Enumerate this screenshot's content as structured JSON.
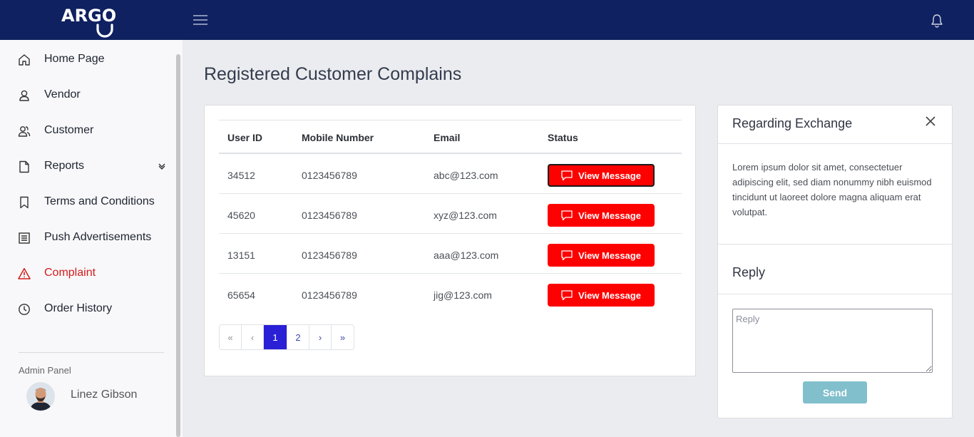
{
  "header": {
    "logo_text": "ARGO",
    "menu_icon": "hamburger-menu-icon",
    "notification_icon": "bell-icon"
  },
  "sidebar": {
    "items": [
      {
        "label": "Home Page",
        "icon": "home-icon"
      },
      {
        "label": "Vendor",
        "icon": "user-icon"
      },
      {
        "label": "Customer",
        "icon": "users-icon"
      },
      {
        "label": "Reports",
        "icon": "document-icon",
        "has_submenu": true
      },
      {
        "label": "Terms and Conditions",
        "icon": "bookmark-icon"
      },
      {
        "label": "Push Advertisements",
        "icon": "list-icon"
      },
      {
        "label": "Complaint",
        "icon": "warning-icon",
        "active": true
      },
      {
        "label": "Order History",
        "icon": "clock-icon"
      }
    ],
    "admin_label": "Admin Panel",
    "admin_name": "Linez Gibson"
  },
  "main": {
    "title": "Registered Customer Complains",
    "table": {
      "headers": [
        "User ID",
        "Mobile Number",
        "Email",
        "Status"
      ],
      "rows": [
        {
          "user_id": "34512",
          "mobile": "0123456789",
          "email": "abc@123.com",
          "action": "View Message"
        },
        {
          "user_id": "45620",
          "mobile": "0123456789",
          "email": "xyz@123.com",
          "action": "View Message"
        },
        {
          "user_id": "13151",
          "mobile": "0123456789",
          "email": "aaa@123.com",
          "action": "View Message"
        },
        {
          "user_id": "65654",
          "mobile": "0123456789",
          "email": "jig@123.com",
          "action": "View Message"
        }
      ]
    },
    "pagination": {
      "first": "«",
      "prev": "‹",
      "pages": [
        "1",
        "2"
      ],
      "current": "1",
      "next": "›",
      "last": "»"
    }
  },
  "message_panel": {
    "title": "Regarding Exchange",
    "body": "Lorem ipsum dolor sit amet, consectetuer adipiscing elit, sed diam nonummy nibh euismod tincidunt ut laoreet dolore magna aliquam erat volutpat.",
    "reply_title": "Reply",
    "reply_placeholder": "Reply",
    "send_label": "Send"
  },
  "colors": {
    "topbar": "#0f2160",
    "active_nav": "#d41b1b",
    "action_button": "#ff0000",
    "pager_active": "#2a20d6",
    "send_button": "#81bfcc"
  }
}
